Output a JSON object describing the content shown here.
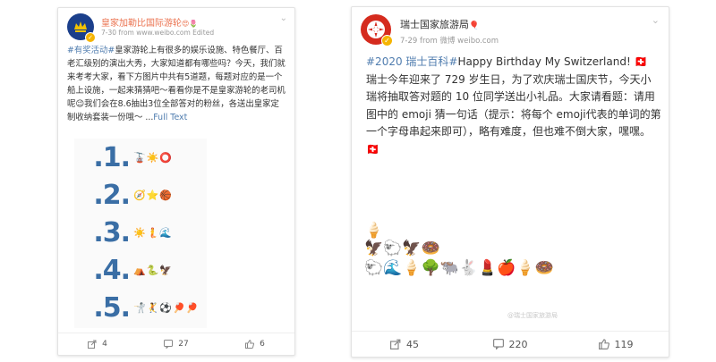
{
  "left_post": {
    "name": "皇家加勒比国际游轮",
    "name_emojis": "😍🌷",
    "meta": "7-30  from www.weibo.com Edited",
    "tag": "#有奖活动#",
    "body": "皇家游轮上有很多的娱乐设施、特色餐厅、百老汇级别的演出大秀，大家知道都有哪些吗？今天，我们就来考考大家，看下方图片中共有5道题，每题对应的是一个船上设施，一起来猜猜吧～看看你是不是皇家游轮的老司机呢😉我们会在8.6抽出3位全部答对的粉丝，各送出皇家定制收纳套装一份哦～ ...",
    "full_text_link": "Full Text",
    "quiz": [
      {
        "num": ".1.",
        "emojis": "🚡☀️⭕"
      },
      {
        "num": ".2.",
        "emojis": "🧭⭐🏀"
      },
      {
        "num": ".3.",
        "emojis": "☀️🧜🌊"
      },
      {
        "num": ".4.",
        "emojis": "⛺🐍🦅"
      },
      {
        "num": ".5.",
        "emojis": "🤺🤾⚽🏓🏓"
      }
    ],
    "footer": {
      "share": "4",
      "comments": "27",
      "likes": "6"
    }
  },
  "right_post": {
    "name": "瑞士国家旅游局",
    "name_emoji": "🎈",
    "meta": "7-29  from 微博 weibo.com",
    "tag": "#2020 瑞士百科#",
    "body_1": "Happy Birthday My Switzerland! 🇨🇭 瑞士今年迎来了 729 岁生日，为了欢庆瑞士国庆节，今天小瑞将抽取答对题的 10 位同学送出小礼品。大家请看题：请用图中的 emoji 猜一句话（提示：将每个 emoji代表的单词的第一个字母串起来即可），略有难度，但也难不倒大家，嘿嘿。🇨🇭",
    "emoji_line_1": "🍦",
    "emoji_line_2": "🦅🐑🦅🍩",
    "emoji_line_3": "🐑🌊🍦🌳🐃🐇💄🍎🍦🍩",
    "watermark": "@瑞士国家旅游局",
    "footer": {
      "share": "45",
      "comments": "220",
      "likes": "119"
    }
  },
  "colors": {
    "name": "#eb7350",
    "link": "#507daf",
    "verified": "#f5b400",
    "swiss_red": "#d52b1e",
    "royal_blue": "#1b3f8b"
  },
  "icons": [
    "chevron-down-icon",
    "share-icon",
    "comment-icon",
    "like-icon",
    "verified-badge-icon"
  ]
}
